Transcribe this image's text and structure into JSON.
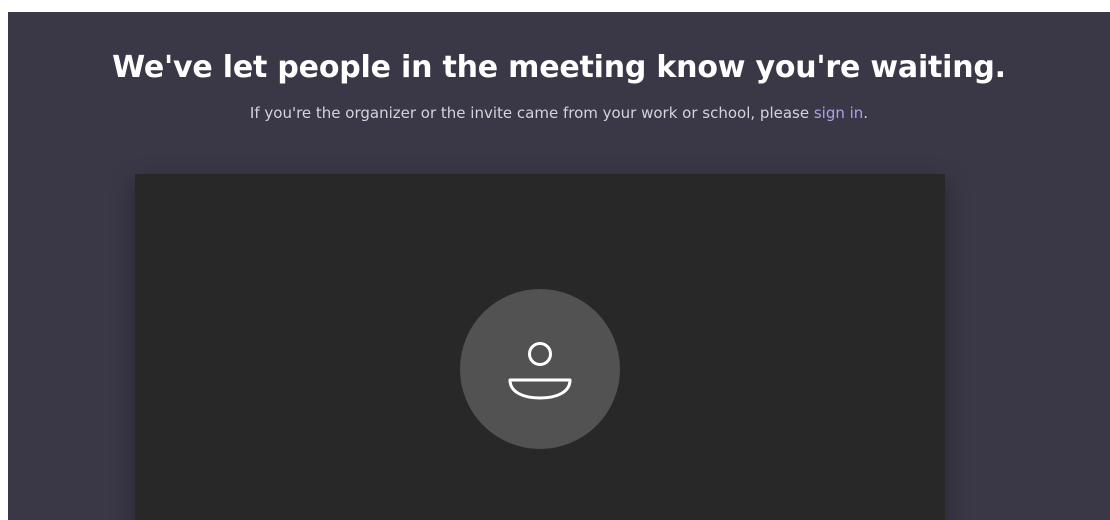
{
  "lobby": {
    "heading": "We've let people in the meeting know you're waiting.",
    "subtext_before": "If you're the organizer or the invite came from your work or school, please ",
    "signin_link": "sign in",
    "subtext_after": "."
  },
  "preview": {
    "avatar_icon": "person-icon"
  },
  "colors": {
    "background": "#3a3847",
    "preview_background": "#282828",
    "avatar_background": "#525252",
    "link": "#a9a3e6"
  }
}
